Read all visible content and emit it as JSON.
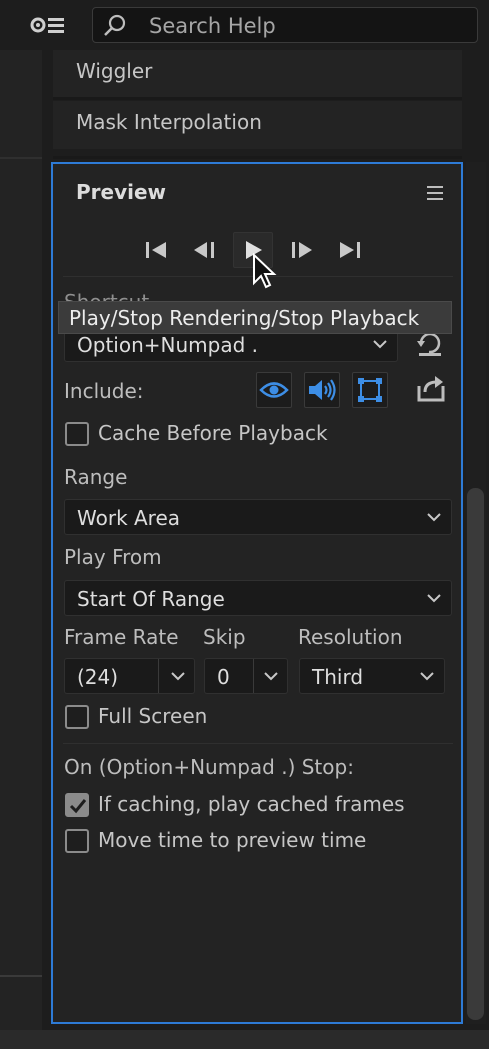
{
  "topbar": {
    "workspace_icon": "workspace-settings-icon",
    "search": {
      "placeholder": "Search Help",
      "icon": "search-icon"
    }
  },
  "panels": {
    "wiggler": "Wiggler",
    "mask_interpolation": "Mask Interpolation"
  },
  "preview": {
    "title": "Preview",
    "menu_icon": "hamburger-icon",
    "transport": [
      "first-frame",
      "previous-frame",
      "play",
      "next-frame",
      "last-frame"
    ],
    "shortcut_label": "Shortcut",
    "shortcut_value": "Option+Numpad .",
    "tooltip": "Play/Stop Rendering/Stop Playback",
    "include_label": "Include:",
    "cache_before_playback": {
      "label": "Cache Before Playback",
      "checked": false
    },
    "range_label": "Range",
    "range_value": "Work Area",
    "play_from_label": "Play From",
    "play_from_value": "Start Of Range",
    "frame_rate_label": "Frame Rate",
    "frame_rate_value": "(24)",
    "skip_label": "Skip",
    "skip_value": "0",
    "resolution_label": "Resolution",
    "resolution_value": "Third",
    "full_screen": {
      "label": "Full Screen",
      "checked": false
    },
    "stop_heading": "On (Option+Numpad .) Stop:",
    "if_caching": {
      "label": "If caching, play cached frames",
      "checked": true
    },
    "move_time": {
      "label": "Move time to preview time",
      "checked": false
    }
  },
  "colors": {
    "accent": "#2e7bd6",
    "panel_bg": "#232323",
    "app_bg": "#1d1d1d",
    "icon_blue": "#3d8ee6"
  }
}
